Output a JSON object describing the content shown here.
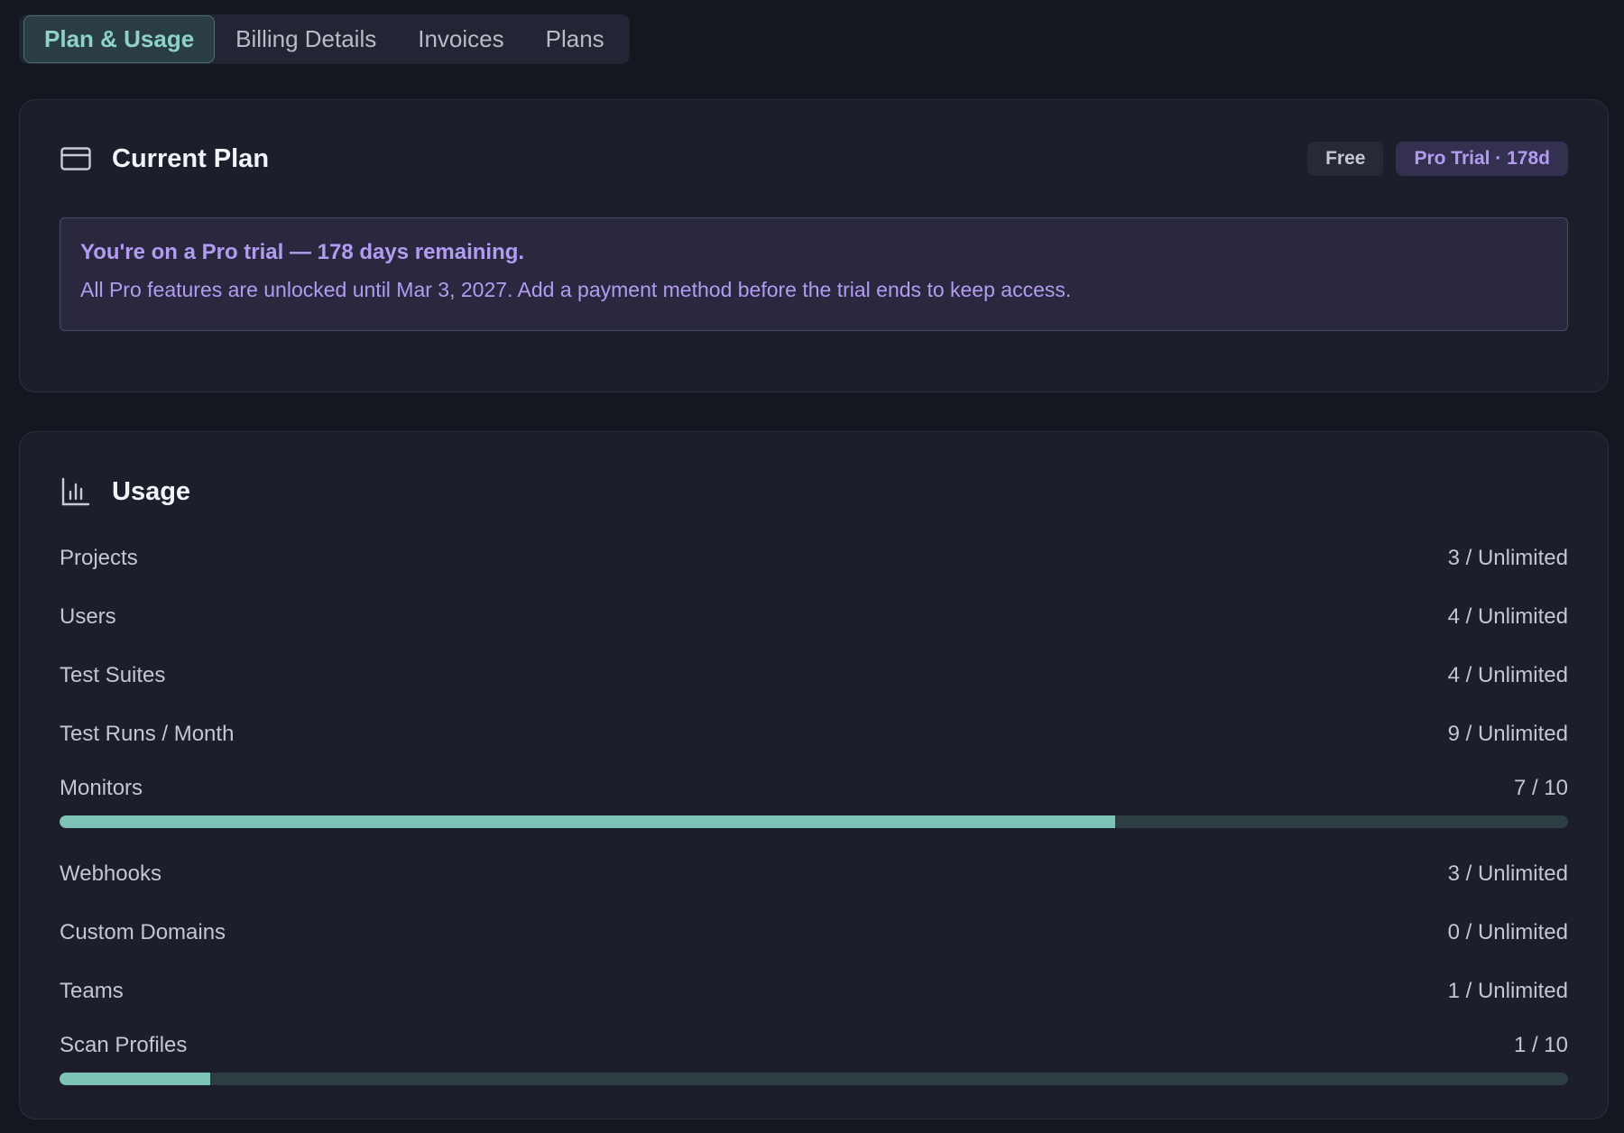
{
  "tabs": [
    {
      "label": "Plan & Usage",
      "active": true
    },
    {
      "label": "Billing Details",
      "active": false
    },
    {
      "label": "Invoices",
      "active": false
    },
    {
      "label": "Plans",
      "active": false
    }
  ],
  "current_plan": {
    "title": "Current Plan",
    "icon": "credit-card-icon",
    "badges": {
      "free": "Free",
      "trial": "Pro Trial · 178d"
    },
    "notice": {
      "title": "You're on a Pro trial — 178 days remaining.",
      "body": "All Pro features are unlocked until Mar 3, 2027. Add a payment method before the trial ends to keep access."
    }
  },
  "usage": {
    "title": "Usage",
    "icon": "bar-chart-icon",
    "rows": [
      {
        "label": "Projects",
        "value": "3 / Unlimited"
      },
      {
        "label": "Users",
        "value": "4 / Unlimited"
      },
      {
        "label": "Test Suites",
        "value": "4 / Unlimited"
      },
      {
        "label": "Test Runs / Month",
        "value": "9 / Unlimited"
      },
      {
        "label": "Monitors",
        "value": "7 / 10",
        "progress": 0.7
      },
      {
        "label": "Webhooks",
        "value": "3 / Unlimited"
      },
      {
        "label": "Custom Domains",
        "value": "0 / Unlimited"
      },
      {
        "label": "Teams",
        "value": "1 / Unlimited"
      },
      {
        "label": "Scan Profiles",
        "value": "1 / 10",
        "progress": 0.1
      }
    ]
  },
  "colors": {
    "accent": "#8fd3c6",
    "bar_fill": "#7ec4b6",
    "bar_track": "#2c3e41",
    "trial_purple": "#b29cf1"
  }
}
